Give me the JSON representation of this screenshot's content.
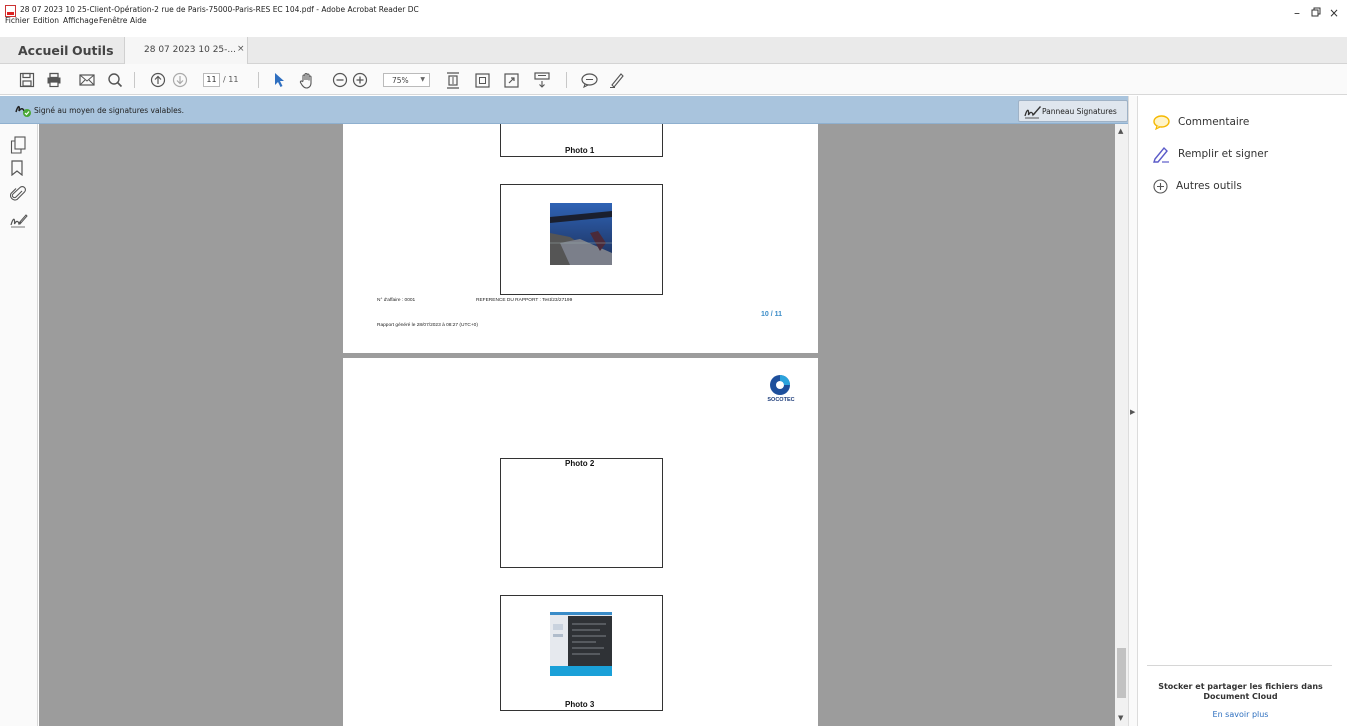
{
  "window": {
    "title": "28 07 2023 10 25-Client-Opération-2 rue de Paris-75000-Paris-RES EC 104.pdf - Adobe Acrobat Reader DC",
    "controls": {
      "minimize": "–",
      "maximize": "▫",
      "close": "×"
    }
  },
  "menu": [
    "Fichier",
    "Edition",
    "Affichage",
    "Fenêtre",
    "Aide"
  ],
  "tabs": {
    "home": "Accueil",
    "tools": "Outils",
    "document": "28 07 2023 10 25-...",
    "close": "×"
  },
  "toolbar": {
    "current_page": "11",
    "total_pages": "/ 11",
    "zoom": "75%"
  },
  "signature_bar": {
    "message": "Signé au moyen de signatures valables.",
    "panel_button": "Panneau Signatures"
  },
  "document": {
    "page10": {
      "photo1_caption": "Photo 1",
      "affaire": "N° d'affaire : 0001",
      "reference": "REFERENCE DU RAPPORT : Test/23/27199",
      "generated": "Rapport généré le 28/07/2023 à 08:27 (UTC+0)",
      "page_number": "10 / 11"
    },
    "page11": {
      "logo_text": "SOCOTEC",
      "photo2_caption": "Photo 2",
      "photo3_caption": "Photo 3"
    }
  },
  "right_pane": {
    "items": [
      "Commentaire",
      "Remplir et signer",
      "Autres outils"
    ],
    "cloud_promo": "Stocker et partager les fichiers dans Document Cloud",
    "learn_more": "En savoir plus"
  },
  "colors": {
    "signature_bar": "#a9c4dd",
    "viewport_bg": "#9c9c9c",
    "page_number": "#3a8cc8",
    "link": "#2d6fbf",
    "comment_icon": "#f5b800",
    "sign_icon": "#5b5bc9"
  },
  "icons": {
    "left_rail": [
      "pages-icon",
      "bookmark-icon",
      "attachment-icon",
      "signature-icon"
    ],
    "toolbar": [
      "save-icon",
      "print-icon",
      "email-icon",
      "search-icon",
      "page-up-icon",
      "page-down-icon",
      "select-arrow-icon",
      "hand-icon",
      "zoom-out-icon",
      "zoom-in-icon",
      "fit-page-icon",
      "fit-width-icon",
      "fullscreen-icon",
      "scroll-mode-icon",
      "comment-icon",
      "highlight-pen-icon"
    ]
  }
}
